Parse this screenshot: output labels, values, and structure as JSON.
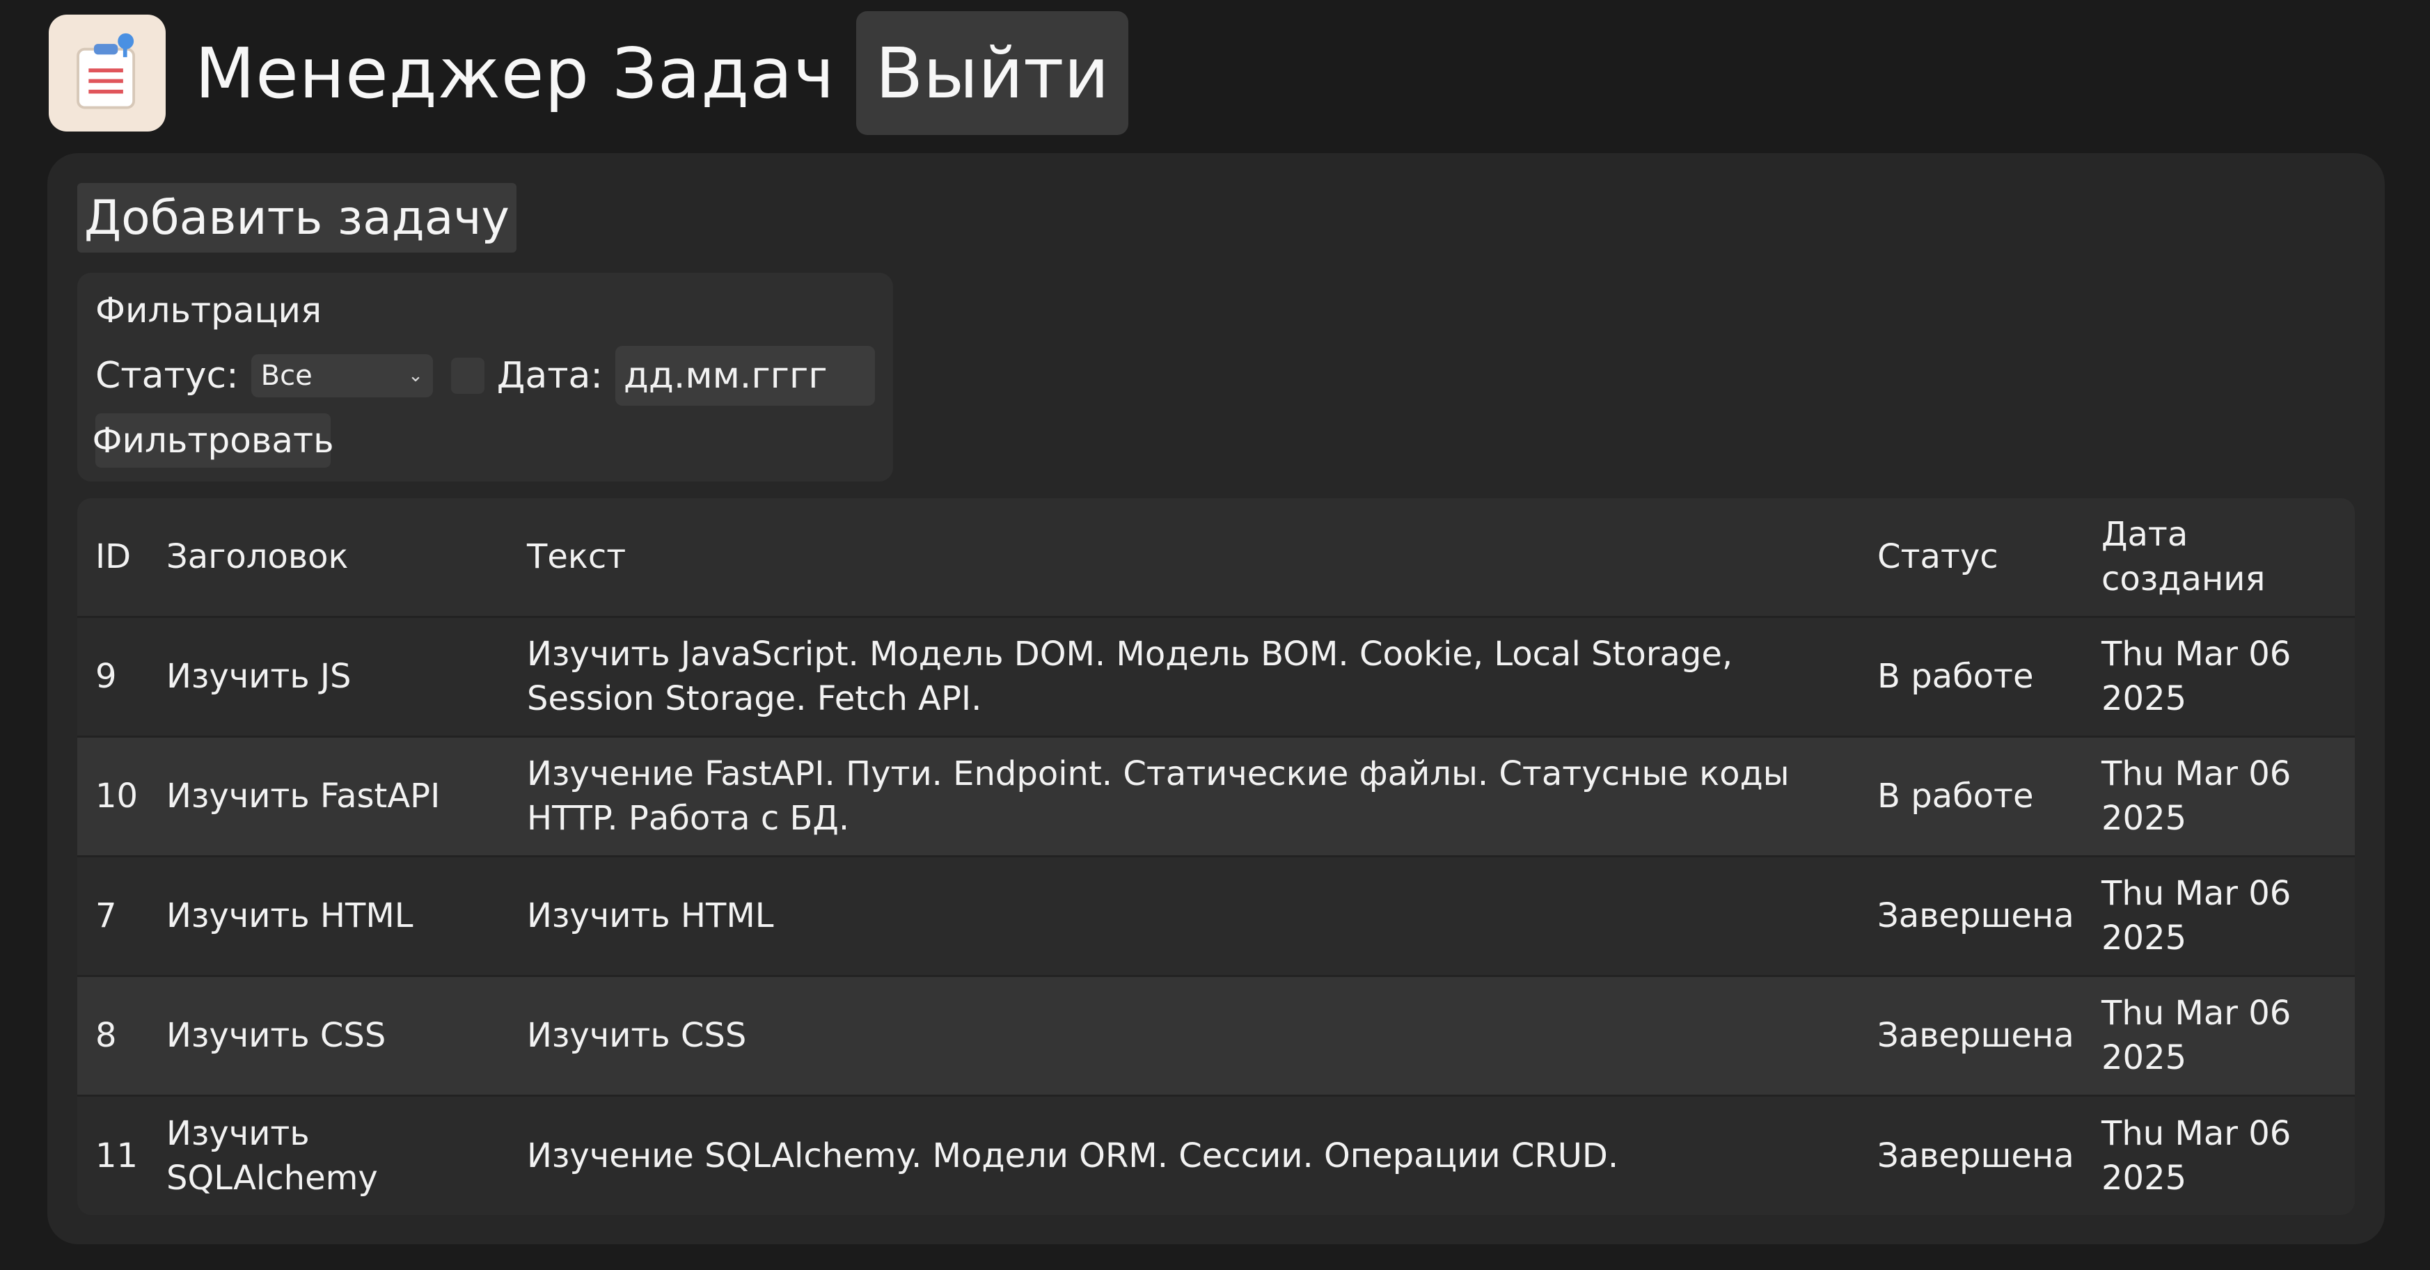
{
  "header": {
    "title": "Менеджер Задач",
    "logout_label": "Выйти",
    "logo_icon": "clipboard-icon"
  },
  "actions": {
    "add_task_label": "Добавить задачу"
  },
  "filter": {
    "title": "Фильтрация",
    "status_label": "Статус:",
    "status_value": "Все",
    "date_label": "Дата:",
    "date_placeholder": "дд.мм.гггг",
    "date_checked": false,
    "submit_label": "Фильтровать"
  },
  "table": {
    "headers": {
      "id": "ID",
      "title": "Заголовок",
      "text": "Текст",
      "status": "Статус",
      "date": "Дата создания"
    },
    "rows": [
      {
        "id": "9",
        "title": "Изучить JS",
        "text": "Изучить JavaScript. Модель DOM. Модель BOM. Cookie, Local Storage, Session Storage. Fetch API.",
        "status": "В работе",
        "date": "Thu Mar 06 2025"
      },
      {
        "id": "10",
        "title": "Изучить FastAPI",
        "text": "Изучение FastAPI. Пути. Endpoint. Статические файлы. Статусные коды HTTP. Работа с БД.",
        "status": "В работе",
        "date": "Thu Mar 06 2025"
      },
      {
        "id": "7",
        "title": "Изучить HTML",
        "text": "Изучить HTML",
        "status": "Завершена",
        "date": "Thu Mar 06 2025"
      },
      {
        "id": "8",
        "title": "Изучить CSS",
        "text": "Изучить CSS",
        "status": "Завершена",
        "date": "Thu Mar 06 2025"
      },
      {
        "id": "11",
        "title": "Изучить SQLAlchemy",
        "text": "Изучение SQLAlchemy. Модели ORM. Сессии. Операции CRUD.",
        "status": "Завершена",
        "date": "Thu Mar 06 2025"
      }
    ]
  }
}
